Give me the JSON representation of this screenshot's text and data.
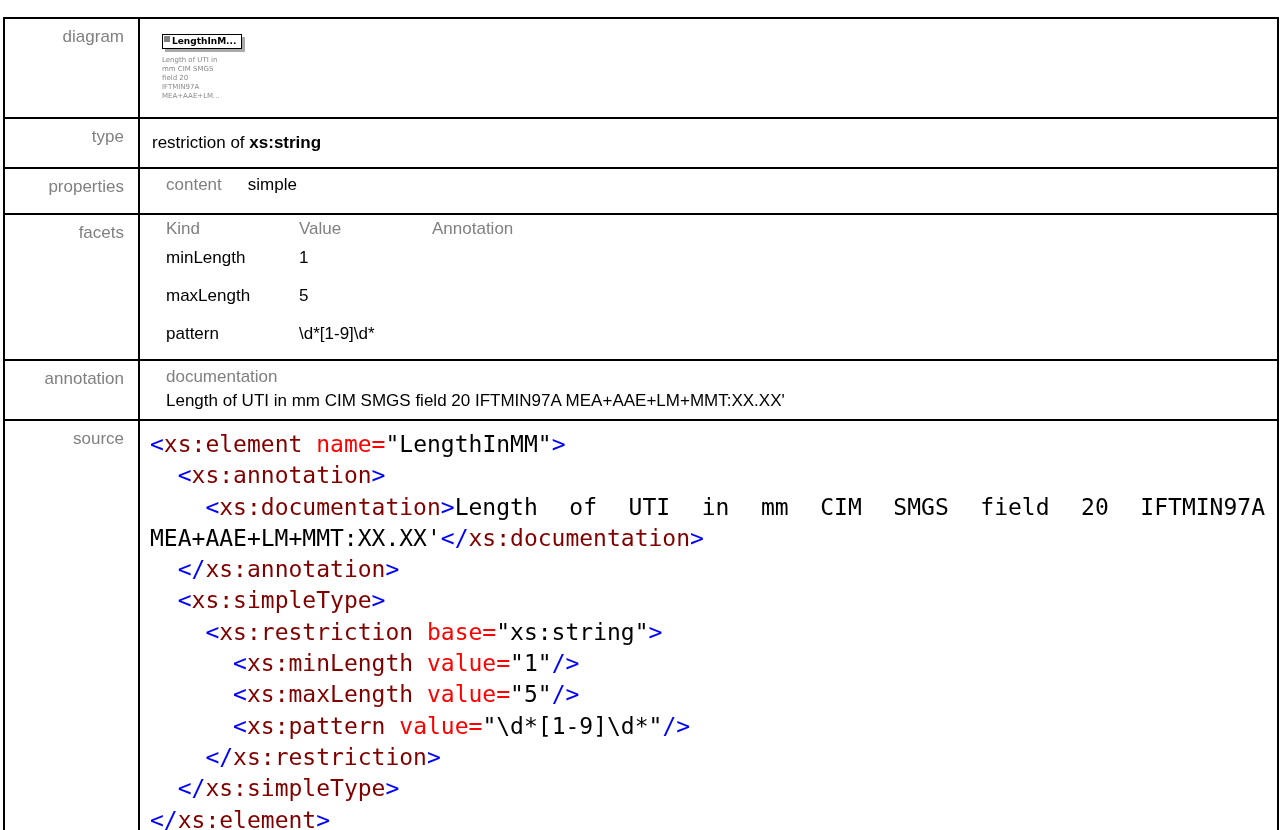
{
  "rows": [
    {
      "kind": "diagram",
      "label": "diagram",
      "element": {
        "name": "LengthInM...",
        "note_lines": [
          "Length of UTI in",
          "mm CIM SMGS",
          "field 20",
          "IFTMIN97A",
          "MEA+AAE+LM..."
        ]
      }
    },
    {
      "kind": "type",
      "label": "type",
      "text": "restriction of **xs:string**"
    },
    {
      "kind": "properties",
      "label": "properties",
      "key": "content",
      "value": "simple"
    },
    {
      "kind": "facets",
      "label": "facets",
      "columns": [
        "Kind",
        "Value",
        "Annotation"
      ],
      "items": [
        {
          "name": "minLength",
          "value": "1"
        },
        {
          "name": "maxLength",
          "value": "5"
        },
        {
          "name": "pattern",
          "value": "\\d*[1-9]\\d*"
        }
      ]
    },
    {
      "kind": "annotation",
      "label": "annotation",
      "heading": "documentation",
      "text": "Length of UTI in mm CIM SMGS field 20 IFTMIN97A MEA+AAE+LM+MMT:XX.XX'"
    },
    {
      "kind": "source",
      "label": "source",
      "lines": [
        [
          {
            "kind": "punct",
            "text": "<"
          },
          {
            "kind": "tag",
            "text": "xs:element"
          },
          {
            "kind": "attr",
            "text": " name="
          },
          {
            "kind": "value",
            "text": "\"LengthInMM\""
          },
          {
            "kind": "punct",
            "text": ">"
          }
        ],
        [
          {
            "kind": "punct",
            "text": "  <"
          },
          {
            "kind": "tag",
            "text": "xs:annotation"
          },
          {
            "kind": "punct",
            "text": ">"
          }
        ],
        [
          {
            "kind": "punct",
            "text": "    <"
          },
          {
            "kind": "tag",
            "text": "xs:documentation"
          },
          {
            "kind": "punct",
            "text": ">"
          },
          {
            "kind": "text",
            "text": "Length of UTI in mm CIM SMGS field 20 IFTMIN97A"
          }
        ],
        [
          {
            "kind": "text",
            "text": "MEA+AAE+LM+MMT:XX.XX'"
          },
          {
            "kind": "punct",
            "text": "</"
          },
          {
            "kind": "tag",
            "text": "xs:documentation"
          },
          {
            "kind": "punct",
            "text": ">"
          }
        ],
        [
          {
            "kind": "punct",
            "text": "  </"
          },
          {
            "kind": "tag",
            "text": "xs:annotation"
          },
          {
            "kind": "punct",
            "text": ">"
          }
        ],
        [
          {
            "kind": "punct",
            "text": "  <"
          },
          {
            "kind": "tag",
            "text": "xs:simpleType"
          },
          {
            "kind": "punct",
            "text": ">"
          }
        ],
        [
          {
            "kind": "punct",
            "text": "    <"
          },
          {
            "kind": "tag",
            "text": "xs:restriction"
          },
          {
            "kind": "attr",
            "text": " base="
          },
          {
            "kind": "value",
            "text": "\"xs:string\""
          },
          {
            "kind": "punct",
            "text": ">"
          }
        ],
        [
          {
            "kind": "punct",
            "text": "      <"
          },
          {
            "kind": "tag",
            "text": "xs:minLength"
          },
          {
            "kind": "attr",
            "text": " value="
          },
          {
            "kind": "value",
            "text": "\"1\""
          },
          {
            "kind": "punct",
            "text": "/>"
          }
        ],
        [
          {
            "kind": "punct",
            "text": "      <"
          },
          {
            "kind": "tag",
            "text": "xs:maxLength"
          },
          {
            "kind": "attr",
            "text": " value="
          },
          {
            "kind": "value",
            "text": "\"5\""
          },
          {
            "kind": "punct",
            "text": "/>"
          }
        ],
        [
          {
            "kind": "punct",
            "text": "      <"
          },
          {
            "kind": "tag",
            "text": "xs:pattern"
          },
          {
            "kind": "attr",
            "text": " value="
          },
          {
            "kind": "value",
            "text": "\"\\d*[1-9]\\d*\""
          },
          {
            "kind": "punct",
            "text": "/>"
          }
        ],
        [
          {
            "kind": "punct",
            "text": "    </"
          },
          {
            "kind": "tag",
            "text": "xs:restriction"
          },
          {
            "kind": "punct",
            "text": ">"
          }
        ],
        [
          {
            "kind": "punct",
            "text": "  </"
          },
          {
            "kind": "tag",
            "text": "xs:simpleType"
          },
          {
            "kind": "punct",
            "text": ">"
          }
        ],
        [
          {
            "kind": "punct",
            "text": "</"
          },
          {
            "kind": "tag",
            "text": "xs:element"
          },
          {
            "kind": "punct",
            "text": ">"
          }
        ]
      ]
    }
  ]
}
